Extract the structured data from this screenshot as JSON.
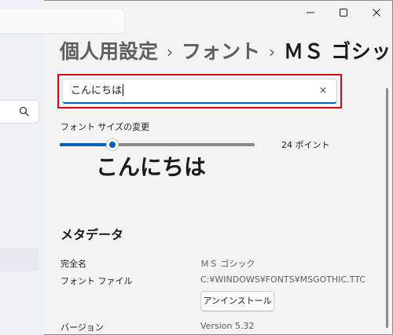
{
  "breadcrumb": [
    "個人用設定",
    "フォント",
    "ＭＳ ゴシック"
  ],
  "breadcrumb_separator": "›",
  "preview": {
    "text": "こんにちは"
  },
  "font_size": {
    "label": "フォント サイズの変更",
    "value_label": "24 ポイント",
    "slider_fraction": 0.27,
    "accent": "#005fb8"
  },
  "sample_text": "こんにちは",
  "metadata": {
    "heading": "メタデータ",
    "full_name_label": "完全名",
    "full_name_value": "ＭＳ ゴシック",
    "file_label": "フォント ファイル",
    "file_value": "C:¥WINDOWS¥FONTS¥MSGOTHIC.TTC",
    "uninstall_label": "アンインストール",
    "version_label": "バージョン",
    "version_value": "Version 5.32"
  },
  "icons": [
    "search-icon",
    "minimize-icon",
    "maximize-icon",
    "close-icon",
    "clear-icon"
  ],
  "highlight_color": "#e0000f"
}
